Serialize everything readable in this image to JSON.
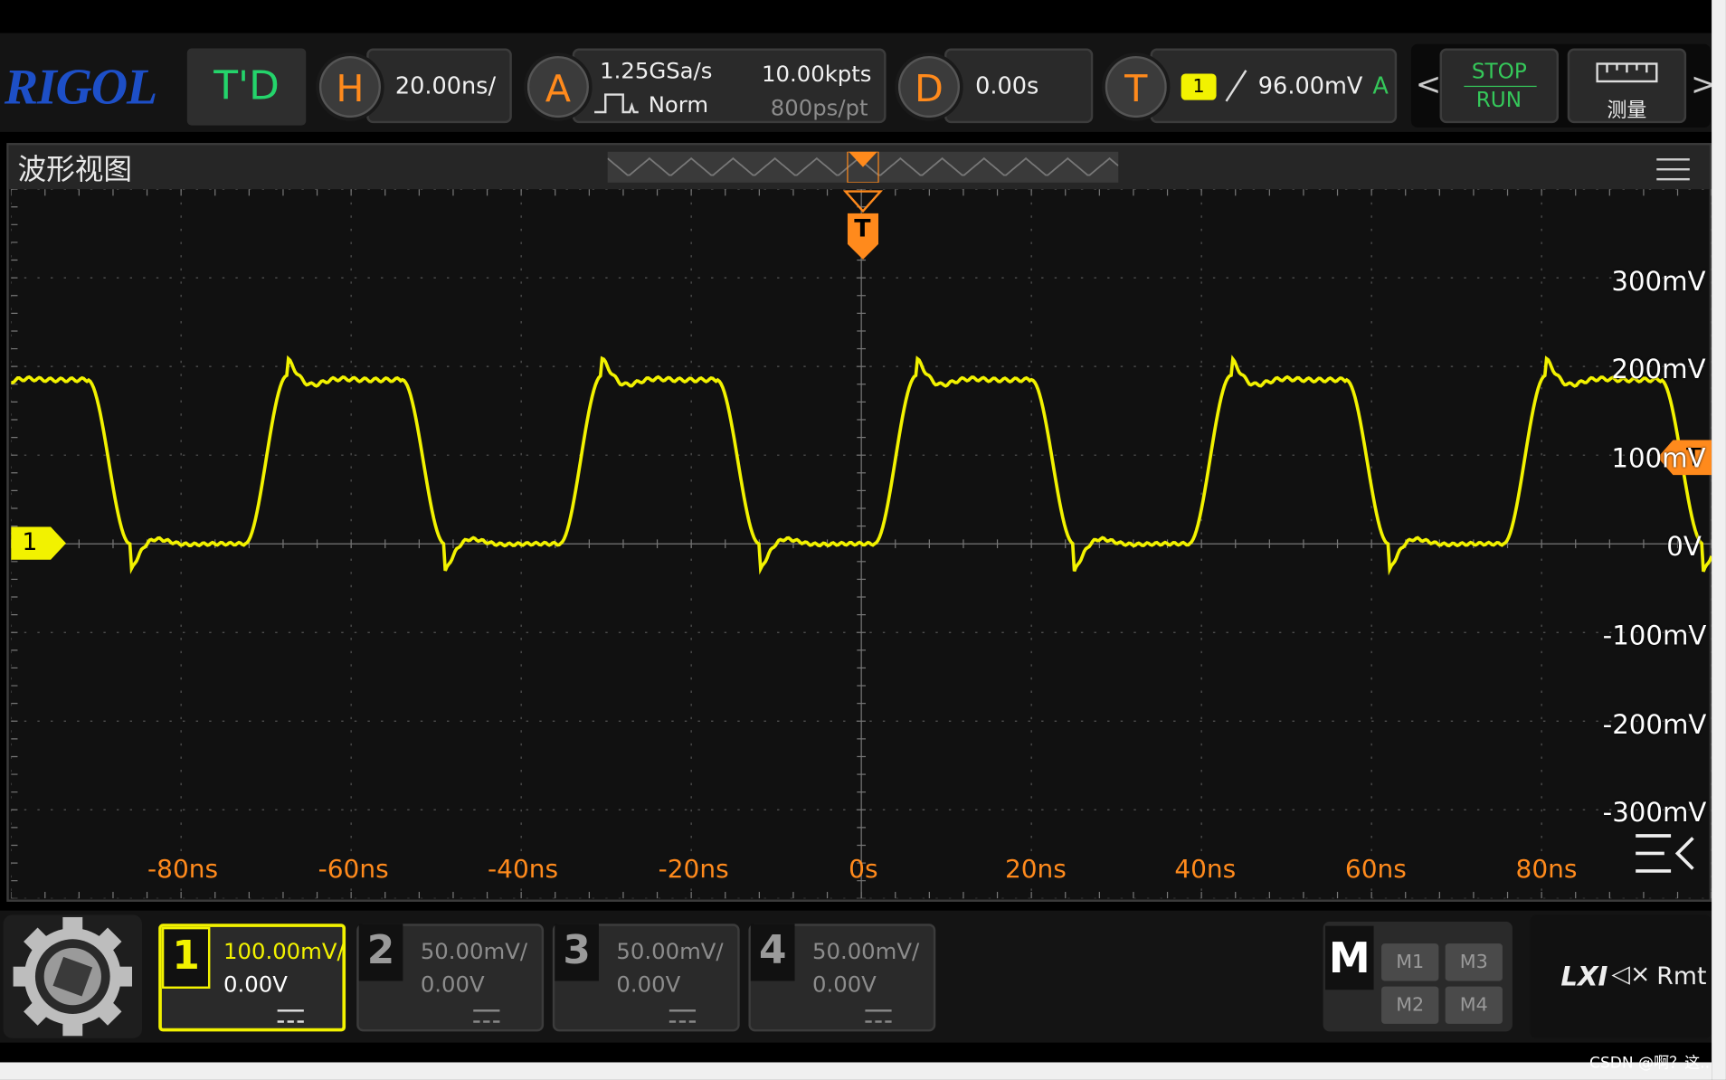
{
  "top": {
    "logo": "RIGOL",
    "mode": "T'D",
    "horizontal": {
      "key": "H",
      "scale": "20.00ns/"
    },
    "acquire": {
      "key": "A",
      "sample_rate": "1.25GSa/s",
      "mode": "Norm",
      "points": "10.00kpts",
      "resolution": "800ps/pt"
    },
    "delay": {
      "key": "D",
      "value": "0.00s"
    },
    "trigger": {
      "key": "T",
      "source": "1",
      "level": "96.00mV",
      "sweep": "A"
    },
    "run": {
      "stop": "STOP",
      "run": "RUN"
    },
    "measure_label": "测量"
  },
  "panel": {
    "title": "波形视图",
    "trigger_marker": "T",
    "trigger_level_marker": "T",
    "channel_marker": "1",
    "volt_labels": [
      "300mV",
      "200mV",
      "100mV",
      "0V",
      "-100mV",
      "-200mV",
      "-300mV"
    ],
    "time_labels": [
      "-80ns",
      "-60ns",
      "-40ns",
      "-20ns",
      "0s",
      "20ns",
      "40ns",
      "60ns",
      "80ns"
    ]
  },
  "channels": [
    {
      "num": "1",
      "scale": "100.00mV/",
      "offset": "0.00V",
      "active": true,
      "color": "#f2f200"
    },
    {
      "num": "2",
      "scale": "50.00mV/",
      "offset": "0.00V",
      "active": false,
      "color": "#808080"
    },
    {
      "num": "3",
      "scale": "50.00mV/",
      "offset": "0.00V",
      "active": false,
      "color": "#808080"
    },
    {
      "num": "4",
      "scale": "50.00mV/",
      "offset": "0.00V",
      "active": false,
      "color": "#808080"
    }
  ],
  "math": {
    "key": "M",
    "items": [
      "M1",
      "M3",
      "M2",
      "M4"
    ]
  },
  "status": {
    "lxi": "LXI",
    "mute": "◁×",
    "remote": "Rmt"
  },
  "watermark": "CSDN @啊？这..",
  "colors": {
    "trace": "#f2f200",
    "trigger": "#ff8a1c",
    "stop_run": "#35c85a",
    "logo": "#1d4fc7"
  }
}
